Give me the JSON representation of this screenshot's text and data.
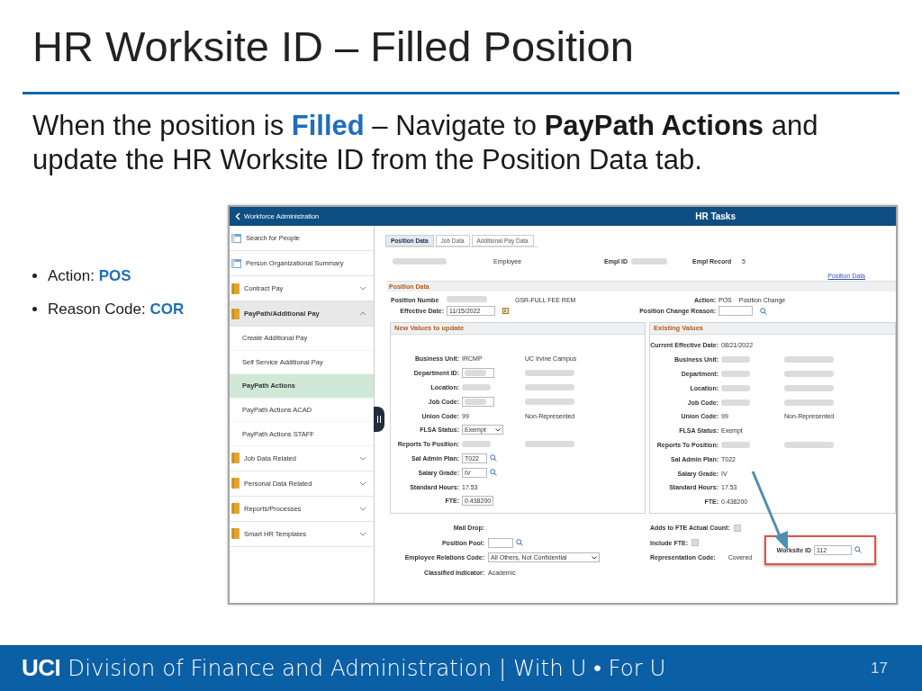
{
  "slide": {
    "title": "HR Worksite ID – Filled Position",
    "intro": [
      {
        "text": "When the position is ",
        "kind": "plain"
      },
      {
        "text": "Filled",
        "kind": "highlight"
      },
      {
        "text": " – Navigate to ",
        "kind": "plain"
      },
      {
        "text": "PayPath Actions",
        "kind": "bold"
      },
      {
        "text": " and update the HR Worksite ID from the Position Data tab.",
        "kind": "plain"
      }
    ],
    "bullets": [
      {
        "label": "Action:",
        "value": "POS"
      },
      {
        "label": "Reason Code:",
        "value": "COR"
      }
    ],
    "footer": {
      "brand": "UCI",
      "tagline": "Division of Finance and Administration | With U • For U",
      "page": "17"
    }
  },
  "app": {
    "header": {
      "back": "Workforce Administration",
      "title": "HR Tasks"
    },
    "sidebar": [
      {
        "label": "Search for People",
        "kind": "page"
      },
      {
        "label": "Person Organizational Summary",
        "kind": "page"
      },
      {
        "label": "Contract Pay",
        "kind": "group",
        "expanded": false
      },
      {
        "label": "PayPath/Additional Pay",
        "kind": "group",
        "expanded": true,
        "children": [
          {
            "label": "Create Additional Pay",
            "selected": false
          },
          {
            "label": "Self Service Additional Pay",
            "selected": false
          },
          {
            "label": "PayPath Actions",
            "selected": true
          },
          {
            "label": "PayPath Actions ACAD",
            "selected": false
          },
          {
            "label": "PayPath Actions STAFF",
            "selected": false
          }
        ]
      },
      {
        "label": "Job Data Related",
        "kind": "group",
        "expanded": false
      },
      {
        "label": "Personal Data Related",
        "kind": "group",
        "expanded": false
      },
      {
        "label": "Reports/Processes",
        "kind": "group",
        "expanded": false
      },
      {
        "label": "Smart HR Templates",
        "kind": "group",
        "expanded": false
      }
    ],
    "tabs": [
      {
        "label": "Position Data",
        "selected": true
      },
      {
        "label": "Job Data",
        "selected": false
      },
      {
        "label": "Additional Pay Data",
        "selected": false
      }
    ],
    "employee": {
      "label": "Employee",
      "empl_id_label": "Empl ID",
      "empl_record_label": "Empl Record",
      "empl_record": "5"
    },
    "link": "Position Data",
    "position_data": {
      "title": "Position Data",
      "position_number": {
        "label": "Position Numbe",
        "description": "GSR-FULL FEE REM"
      },
      "action": {
        "label": "Action:",
        "value": "POS",
        "description": "Position Change"
      },
      "effective_date": {
        "label": "Effective Date:",
        "value": "11/15/2022"
      },
      "change_reason": {
        "label": "Position Change Reason:"
      }
    },
    "panels": [
      {
        "title": "New Values to update",
        "rows": [
          {
            "label": "Business Unit:",
            "kind": "text",
            "value": "IRCMP",
            "note": "UC Irvine Campus"
          },
          {
            "label": "Department ID:",
            "kind": "blurred-input",
            "note_blurred": true
          },
          {
            "label": "Location:",
            "kind": "blurred",
            "note_blurred": true
          },
          {
            "label": "Job Code:",
            "kind": "blurred-input",
            "note_blurred": true
          },
          {
            "label": "Union Code:",
            "kind": "text",
            "value": "99",
            "note": "Non-Represented"
          },
          {
            "label": "FLSA Status:",
            "kind": "select",
            "value": "Exempt"
          },
          {
            "label": "Reports To Position:",
            "kind": "blurred",
            "note_blurred": true
          },
          {
            "label": "Sal Admin Plan:",
            "kind": "input",
            "value": "T022",
            "lookup": true
          },
          {
            "label": "Salary Grade:",
            "kind": "input",
            "value": "IV",
            "lookup": true
          },
          {
            "label": "Standard Hours:",
            "kind": "text",
            "value": "17.53"
          },
          {
            "label": "FTE:",
            "kind": "input",
            "value": "0.438200"
          }
        ]
      },
      {
        "title": "Existing Values",
        "rows": [
          {
            "label": "Current Effective Date:",
            "kind": "text",
            "value": "08/21/2022"
          },
          {
            "label": "Business Unit:",
            "kind": "blurred",
            "note_blurred": true
          },
          {
            "label": "Department:",
            "kind": "blurred",
            "note_blurred": true
          },
          {
            "label": "Location:",
            "kind": "blurred",
            "note_blurred": true
          },
          {
            "label": "Job Code:",
            "kind": "blurred",
            "note_blurred": true
          },
          {
            "label": "Union Code:",
            "kind": "text",
            "value": "99",
            "note": "Non-Represented"
          },
          {
            "label": "FLSA Status:",
            "kind": "text",
            "value": "Exempt"
          },
          {
            "label": "Reports To Position:",
            "kind": "blurred",
            "note_blurred": true
          },
          {
            "label": "Sal Admin Plan:",
            "kind": "text",
            "value": "T022"
          },
          {
            "label": "Salary Grade:",
            "kind": "text",
            "value": "IV"
          },
          {
            "label": "Standard Hours:",
            "kind": "text",
            "value": "17.53"
          },
          {
            "label": "FTE:",
            "kind": "text",
            "value": "0.438200"
          }
        ]
      }
    ],
    "bottom_left": [
      {
        "label": "Mail Drop:",
        "kind": "text"
      },
      {
        "label": "Position Pool:",
        "kind": "input",
        "lookup": true
      },
      {
        "label": "Employee Relations Code:",
        "kind": "select",
        "value": "All Others, Not Confidential"
      },
      {
        "label": "Classified Indicator:",
        "kind": "text",
        "value": "Academic"
      }
    ],
    "bottom_right": [
      {
        "label": "Adds to FTE Actual Count:",
        "kind": "checkbox",
        "checked": false
      },
      {
        "label": "Include FTE:",
        "kind": "checkbox",
        "checked": false
      },
      {
        "label": "Representation Code:",
        "kind": "text",
        "value": "Covered"
      }
    ],
    "worksite": {
      "label": "Worksite ID",
      "value": "112",
      "highlighted": true
    }
  }
}
